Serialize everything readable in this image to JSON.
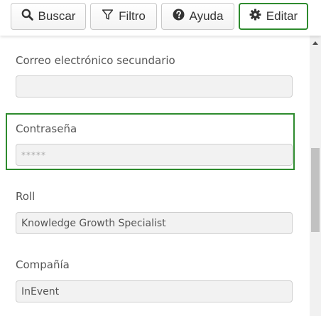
{
  "toolbar": {
    "search_label": "Buscar",
    "filter_label": "Filtro",
    "help_label": "Ayuda",
    "edit_label": "Editar",
    "icons": [
      "search-icon",
      "filter-icon",
      "question-circle-icon",
      "gear-icon"
    ]
  },
  "form": {
    "secondary_email": {
      "label": "Correo electrónico secundario",
      "value": ""
    },
    "password": {
      "label": "Contraseña",
      "value": "*****"
    },
    "role": {
      "label": "Roll",
      "value": "Knowledge Growth Specialist"
    },
    "company": {
      "label": "Compañía",
      "value": "InEvent"
    }
  },
  "colors": {
    "highlight": "#2e8b2e",
    "input_bg": "#f2f2f2",
    "input_border": "#cfcfcf"
  }
}
